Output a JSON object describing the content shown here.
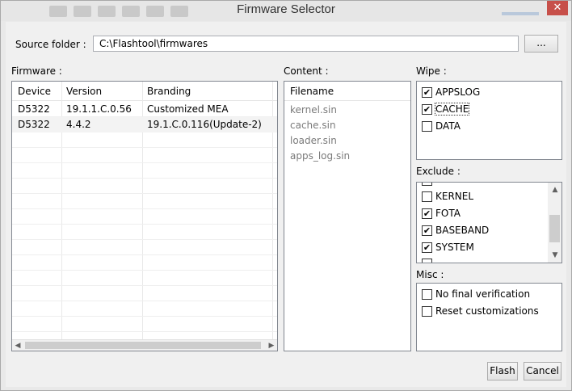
{
  "window": {
    "title": "Firmware Selector",
    "close_glyph": "✕"
  },
  "source": {
    "label": "Source folder :",
    "path": "C:\\Flashtool\\firmwares",
    "browse_label": "..."
  },
  "firmware": {
    "label": "Firmware :",
    "columns": [
      "Device",
      "Version",
      "Branding"
    ],
    "rows": [
      {
        "device": "D5322",
        "version": "19.1.1.C.0.56",
        "branding": "Customized MEA"
      },
      {
        "device": "D5322",
        "version": "4.4.2",
        "branding": "19.1.C.0.116(Update-2)"
      }
    ]
  },
  "content": {
    "label": "Content :",
    "header": "Filename",
    "files": [
      "kernel.sin",
      "cache.sin",
      "loader.sin",
      "apps_log.sin"
    ]
  },
  "wipe": {
    "label": "Wipe :",
    "items": [
      {
        "label": "APPSLOG",
        "checked": true
      },
      {
        "label": "CACHE",
        "checked": true
      },
      {
        "label": "DATA",
        "checked": false
      }
    ]
  },
  "exclude": {
    "label": "Exclude :",
    "items": [
      {
        "label": "KERNEL",
        "checked": false
      },
      {
        "label": "FOTA",
        "checked": true
      },
      {
        "label": "BASEBAND",
        "checked": true
      },
      {
        "label": "SYSTEM",
        "checked": true
      }
    ]
  },
  "misc": {
    "label": "Misc :",
    "items": [
      {
        "label": "No final verification",
        "checked": false
      },
      {
        "label": "Reset customizations",
        "checked": false
      }
    ]
  },
  "buttons": {
    "flash": "Flash",
    "cancel": "Cancel"
  },
  "icons": {
    "check": "✔",
    "up_arrow": "▲",
    "down_arrow": "▼",
    "left_arrow": "◀",
    "right_arrow": "▶"
  }
}
